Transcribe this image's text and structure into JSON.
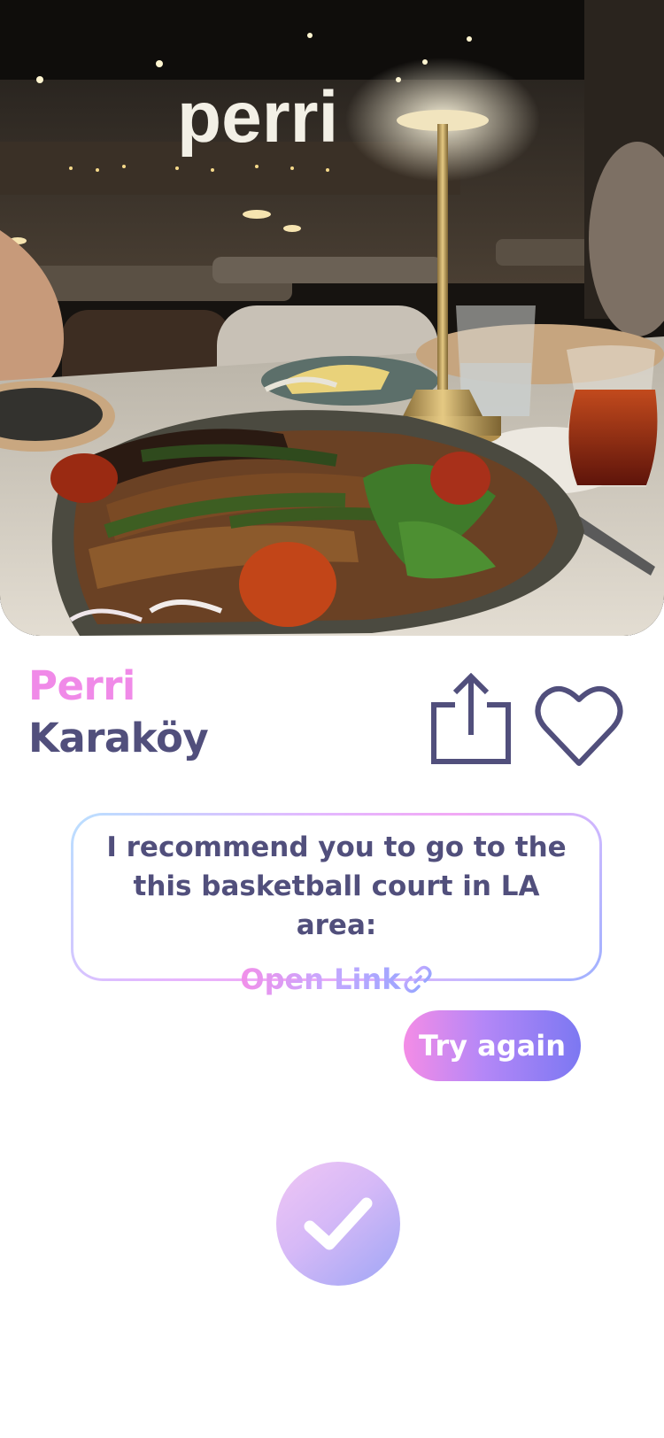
{
  "hero": {
    "image_alt": "Grilled kebab platter on a restaurant table",
    "sign_text": "perri"
  },
  "place": {
    "name": "Perri",
    "area": "Karaköy"
  },
  "actions": {
    "share_icon": "share-icon",
    "favorite_icon": "heart-icon"
  },
  "recommendation": {
    "text": "I recommend you to go to the this basketball court in LA area:",
    "link_label": "Open Link",
    "link_icon": "link-icon"
  },
  "buttons": {
    "try_again_label": "Try again",
    "confirm_icon": "checkmark-icon"
  },
  "colors": {
    "accent_pink": "#f08ae8",
    "text_dark": "#514f7c",
    "gradient_start": "#f48ce6",
    "gradient_end": "#7c78f2"
  }
}
